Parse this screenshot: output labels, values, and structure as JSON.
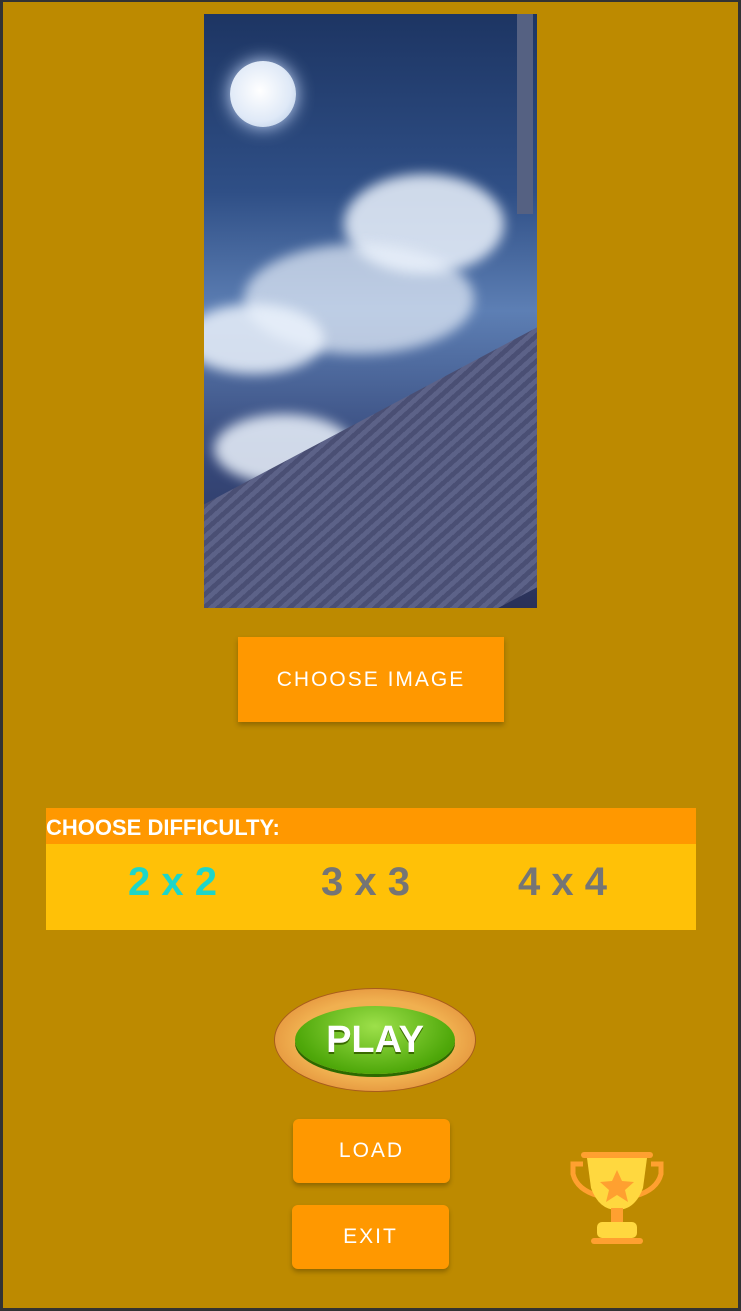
{
  "buttons": {
    "choose_image": "CHOOSE IMAGE",
    "play": "PLAY",
    "load": "LOAD",
    "exit": "EXIT"
  },
  "difficulty": {
    "title": "CHOOSE DIFFICULTY:",
    "options": [
      "2 x 2",
      "3 x 3",
      "4 x 4"
    ],
    "selected": "2 x 2"
  },
  "colors": {
    "background": "#BD8A00",
    "button": "#FF9800",
    "selected": "#1ED6C8",
    "unselected": "#757575"
  }
}
